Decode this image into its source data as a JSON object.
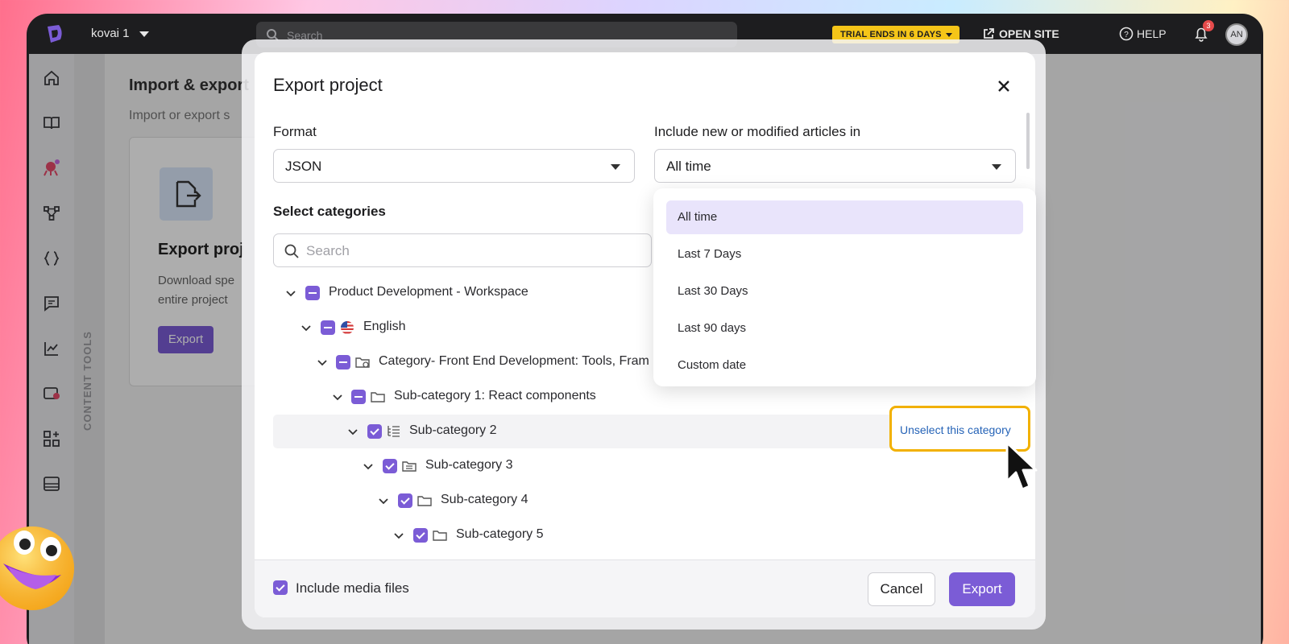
{
  "topbar": {
    "project_name": "kovai 1",
    "search_placeholder": "Search",
    "trial_label": "TRIAL ENDS IN 6 DAYS",
    "open_site_label": "OPEN SITE",
    "help_label": "HELP",
    "notification_count": "3",
    "avatar_initials": "AN"
  },
  "sidebar": {
    "icons": [
      "home-icon",
      "book-icon",
      "bot-icon",
      "workflow-icon",
      "code-icon",
      "comment-icon",
      "analytics-icon",
      "content-tools-icon",
      "apps-icon",
      "layout-icon"
    ],
    "content_tools_label": "CONTENT TOOLS"
  },
  "background": {
    "title": "Import & export",
    "subtitle": "Import or export s",
    "card_title": "Export proj",
    "card_desc_1": "Download spe",
    "card_desc_2": "entire project",
    "card_button": "Export"
  },
  "modal": {
    "title": "Export project",
    "format_label": "Format",
    "format_value": "JSON",
    "include_label": "Include new or modified articles in",
    "include_value": "All time",
    "categories_label": "Select categories",
    "search_placeholder": "Search",
    "tree": [
      {
        "label": "Product Development - Workspace",
        "state": "indeterminate",
        "icon": "none"
      },
      {
        "label": "English",
        "state": "indeterminate",
        "icon": "us-flag-icon"
      },
      {
        "label": "Category- Front End Development: Tools, Fram",
        "state": "indeterminate",
        "icon": "shared-folder-icon"
      },
      {
        "label": "Sub-category 1: React components",
        "state": "indeterminate",
        "icon": "folder-icon"
      },
      {
        "label": "Sub-category 2",
        "state": "checked",
        "icon": "tree-list-icon"
      },
      {
        "label": "Sub-category 3",
        "state": "checked",
        "icon": "document-folder-icon"
      },
      {
        "label": "Sub-category 4",
        "state": "checked",
        "icon": "folder-icon"
      },
      {
        "label": "Sub-category 5",
        "state": "checked",
        "icon": "folder-icon"
      }
    ],
    "unselect_label": "Unselect this category",
    "include_media_label": "Include media files",
    "cancel_label": "Cancel",
    "export_label": "Export"
  },
  "dropdown": {
    "options": [
      "All time",
      "Last 7 Days",
      "Last 30 Days",
      "Last 90 days",
      "Custom date"
    ],
    "selected": "All time"
  },
  "colors": {
    "accent": "#7b5cd6",
    "highlight_border": "#f2b100",
    "link": "#2563b7"
  }
}
